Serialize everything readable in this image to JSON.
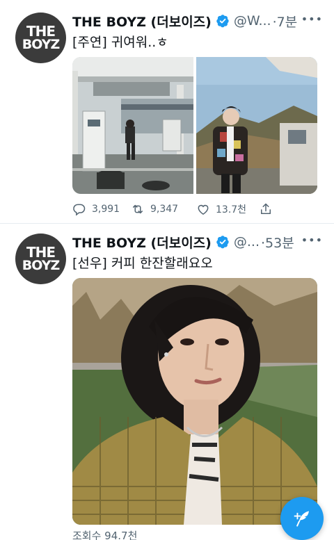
{
  "tweets": [
    {
      "avatar_text_line1": "THE",
      "avatar_text_line2": "BOYZ",
      "name": "THE BOYZ (더보이즈)",
      "handle": "@W...",
      "time": "·7분",
      "text": "[주연] 귀여워..ㅎ",
      "replies": "3,991",
      "retweets": "9,347",
      "likes": "13.7천"
    },
    {
      "avatar_text_line1": "THE",
      "avatar_text_line2": "BOYZ",
      "name": "THE BOYZ (더보이즈)",
      "handle": "@...",
      "time": "·53분",
      "text": "[선우] 커피 한잔할래요오",
      "views": "조회수 94.7천"
    }
  ],
  "icons": {
    "verified": "verified-badge-icon",
    "more": "more-icon",
    "reply": "reply-icon",
    "retweet": "retweet-icon",
    "like": "heart-icon",
    "share": "share-icon",
    "compose": "compose-tweet-icon"
  },
  "colors": {
    "accent": "#1d9bf0",
    "secondary_text": "#536471",
    "primary_text": "#0f1419"
  }
}
